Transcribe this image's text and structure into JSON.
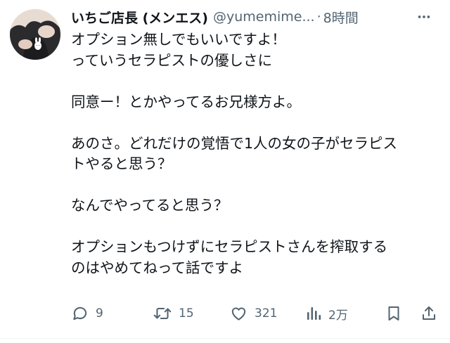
{
  "author": {
    "display_name": "いちご店長 (メンエス)",
    "handle": "@yumemime...",
    "separator": "·",
    "time": "8時間"
  },
  "body": {
    "paragraphs": [
      [
        "オプション無しでもいいですよ！",
        "っていうセラピストの優しさに"
      ],
      [
        "同意ー！とかやってるお兄様方よ。"
      ],
      [
        "あのさ。どれだけの覚悟で1人の女の子がセラピス",
        "トやると思う？"
      ],
      [
        "なんでやってると思う？"
      ],
      [
        "オプションもつけずにセラピストさんを搾取する",
        "のはやめてねって話ですよ"
      ]
    ]
  },
  "actions": {
    "reply_count": "9",
    "retweet_count": "15",
    "like_count": "321",
    "view_count": "2万"
  },
  "icons": {
    "avatar": "avatar-photo",
    "more": "more-icon",
    "reply": "reply-icon",
    "retweet": "retweet-icon",
    "like": "heart-icon",
    "views": "views-icon",
    "bookmark": "bookmark-icon",
    "share": "share-icon"
  },
  "colors": {
    "text": "#0f1419",
    "secondary": "#536471",
    "divider": "#eff3f4"
  }
}
